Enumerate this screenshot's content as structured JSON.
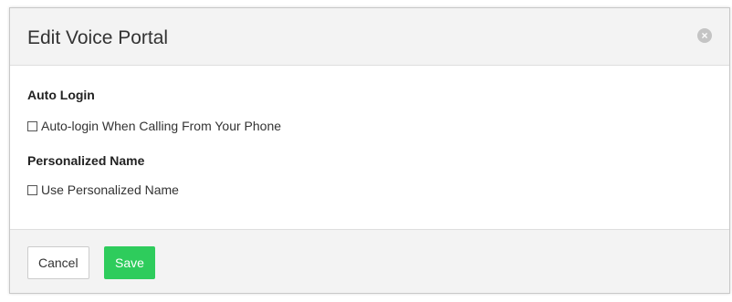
{
  "dialog": {
    "title": "Edit Voice Portal",
    "close_icon": "close-icon",
    "close_glyph": "×"
  },
  "sections": {
    "auto_login": {
      "heading": "Auto Login",
      "checkbox_label": "Auto-login When Calling From Your Phone",
      "checked": false
    },
    "personalized_name": {
      "heading": "Personalized Name",
      "checkbox_label": "Use Personalized Name",
      "checked": false
    }
  },
  "footer": {
    "cancel_label": "Cancel",
    "save_label": "Save"
  },
  "colors": {
    "save_button": "#2ecc5c",
    "header_background": "#f3f3f3"
  }
}
